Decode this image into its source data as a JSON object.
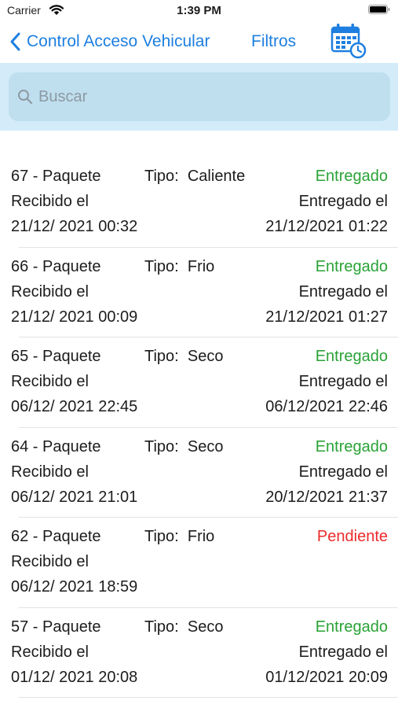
{
  "status_bar": {
    "carrier": "Carrier",
    "time": "1:39 PM"
  },
  "nav": {
    "back_label": "Control Acceso Vehicular",
    "filters_label": "Filtros"
  },
  "search": {
    "placeholder": "Buscar"
  },
  "colors": {
    "accent": "#1e7fe0",
    "delivered": "#2aa236",
    "pending": "#ee2a2a",
    "search_bg": "#d4ecf9"
  },
  "packages": [
    {
      "title": "67 - Paquete",
      "tipo_label": "Tipo:",
      "tipo": "Caliente",
      "status": "Entregado",
      "received_label": "Recibido el",
      "received_date": "21/12/ 2021 00:32",
      "delivered_label": "Entregado el",
      "delivered_date": "21/12/2021 01:22"
    },
    {
      "title": "66 - Paquete",
      "tipo_label": "Tipo:",
      "tipo": "Frio",
      "status": "Entregado",
      "received_label": "Recibido el",
      "received_date": "21/12/ 2021 00:09",
      "delivered_label": "Entregado el",
      "delivered_date": "21/12/2021 01:27"
    },
    {
      "title": "65 - Paquete",
      "tipo_label": "Tipo:",
      "tipo": "Seco",
      "status": "Entregado",
      "received_label": "Recibido el",
      "received_date": "06/12/ 2021 22:45",
      "delivered_label": "Entregado el",
      "delivered_date": "06/12/2021 22:46"
    },
    {
      "title": "64 - Paquete",
      "tipo_label": "Tipo:",
      "tipo": "Seco",
      "status": "Entregado",
      "received_label": "Recibido el",
      "received_date": "06/12/ 2021 21:01",
      "delivered_label": "Entregado el",
      "delivered_date": "20/12/2021 21:37"
    },
    {
      "title": "62 - Paquete",
      "tipo_label": "Tipo:",
      "tipo": "Frio",
      "status": "Pendiente",
      "received_label": "Recibido el",
      "received_date": "06/12/ 2021 18:59",
      "delivered_label": "",
      "delivered_date": ""
    },
    {
      "title": "57 - Paquete",
      "tipo_label": "Tipo:",
      "tipo": "Seco",
      "status": "Entregado",
      "received_label": "Recibido el",
      "received_date": "01/12/ 2021 20:08",
      "delivered_label": "Entregado el",
      "delivered_date": "01/12/2021 20:09"
    }
  ]
}
